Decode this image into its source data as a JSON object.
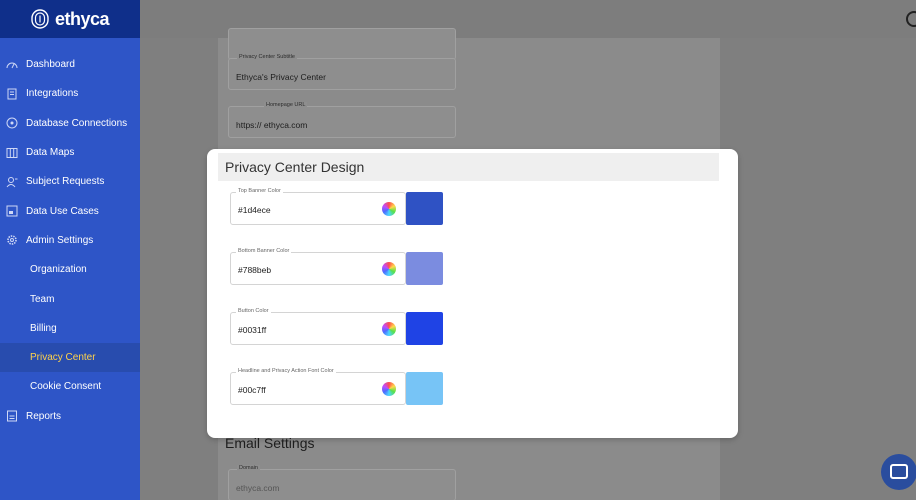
{
  "brand": {
    "name": "ethyca"
  },
  "nav": {
    "items": [
      {
        "label": "Dashboard",
        "icon": "gauge-icon"
      },
      {
        "label": "Integrations",
        "icon": "document-icon"
      },
      {
        "label": "Database Connections",
        "icon": "network-icon"
      },
      {
        "label": "Data Maps",
        "icon": "map-icon"
      },
      {
        "label": "Subject Requests",
        "icon": "user-icon"
      },
      {
        "label": "Data Use Cases",
        "icon": "folder-icon"
      },
      {
        "label": "Admin Settings",
        "icon": "gear-icon"
      }
    ],
    "sub_items": [
      {
        "label": "Organization"
      },
      {
        "label": "Team"
      },
      {
        "label": "Billing"
      },
      {
        "label": "Privacy Center",
        "active": true
      },
      {
        "label": "Cookie Consent"
      }
    ],
    "reports": {
      "label": "Reports",
      "icon": "report-icon"
    }
  },
  "background_form": {
    "subtitle_label": "Privacy Center Subtitle",
    "subtitle_value": "Ethyca's Privacy Center",
    "homepage_label": "Homepage URL",
    "homepage_value": "https:// ethyca.com",
    "email_title": "Email Settings",
    "domain_label": "Domain",
    "domain_value": "ethyca.com"
  },
  "design": {
    "title": "Privacy Center Design",
    "fields": [
      {
        "label": "Top Banner Color",
        "value": "#1d4ece",
        "swatch": "#2f52c4"
      },
      {
        "label": "Bottom Banner Color",
        "value": "#788beb",
        "swatch": "#7b8ce0"
      },
      {
        "label": "Button Color",
        "value": "#0031ff",
        "swatch": "#1f43e5"
      },
      {
        "label": "Headline and Privacy Action Font Color",
        "value": "#00c7ff",
        "swatch": "#77c4f6"
      }
    ]
  },
  "colors": {
    "sidebar": "#2e55c7",
    "sidebar_brand": "#0f2f8a",
    "active_text": "#ffd24a"
  }
}
